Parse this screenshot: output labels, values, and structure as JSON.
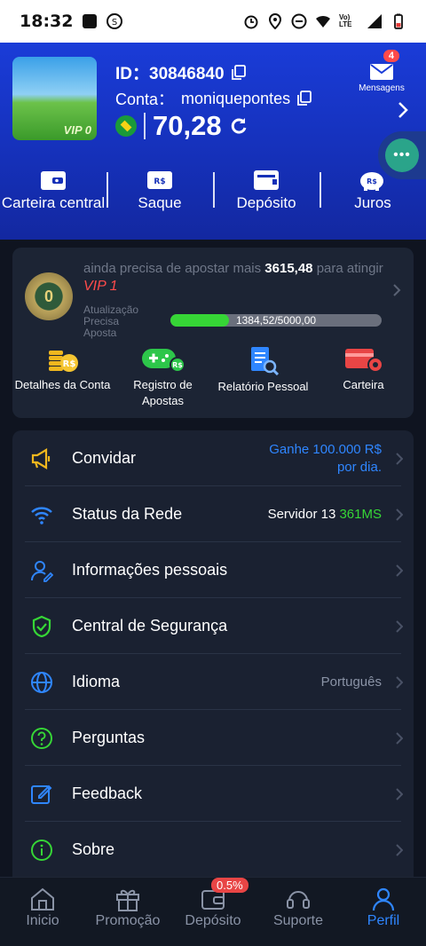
{
  "status_bar": {
    "time": "18:32",
    "network_label": "Vo) LTE"
  },
  "header": {
    "avatar_vip": "VIP 0",
    "id_label": "ID：",
    "id_value": "30846840",
    "account_label": "Conta：",
    "account_value": "moniquepontes",
    "balance": "70,28",
    "messages_label": "Mensagens",
    "messages_count": "4",
    "quick_actions": [
      {
        "label": "Carteira central",
        "icon": "wallet-icon"
      },
      {
        "label": "Saque",
        "icon": "withdraw-ticket-icon"
      },
      {
        "label": "Depósito",
        "icon": "deposit-wallet-icon"
      },
      {
        "label": "Juros",
        "icon": "piggy-bank-icon"
      }
    ]
  },
  "vip": {
    "medal_level": "0",
    "text_prefix": "ainda precisa de apostar mais",
    "amount_needed": "3615,48",
    "text_mid": "para atingir",
    "next_level": "VIP 1",
    "label_line1": "Atualização",
    "label_line2": "Precisa",
    "label_line3": "Aposta",
    "progress_text": "1384,52/5000,00",
    "progress_fraction": 0.2769,
    "actions": [
      {
        "label": "Detalhes da Conta",
        "icon": "coins-icon"
      },
      {
        "label": "Registro de Apostas",
        "icon": "gamepad-icon"
      },
      {
        "label": "Relatório Pessoal",
        "icon": "report-icon"
      },
      {
        "label": "Carteira",
        "icon": "card-settings-icon"
      }
    ]
  },
  "menu": [
    {
      "label": "Convidar",
      "right": "Ganhe 100.000 R$ por dia.",
      "icon": "megaphone-icon"
    },
    {
      "label": "Status da Rede",
      "right": "Servidor 13",
      "right_value": "361MS",
      "icon": "wifi-icon"
    },
    {
      "label": "Informações pessoais",
      "right": "",
      "icon": "user-edit-icon"
    },
    {
      "label": "Central de Segurança",
      "right": "",
      "icon": "shield-check-icon"
    },
    {
      "label": "Idioma",
      "right": "Português",
      "icon": "globe-icon"
    },
    {
      "label": "Perguntas",
      "right": "",
      "icon": "question-icon"
    },
    {
      "label": "Feedback",
      "right": "",
      "icon": "edit-icon"
    },
    {
      "label": "Sobre",
      "right": "",
      "icon": "info-icon"
    }
  ],
  "bottom_nav": [
    {
      "label": "Inicio",
      "icon": "home-icon"
    },
    {
      "label": "Promoção",
      "icon": "gift-icon"
    },
    {
      "label": "Depósito",
      "icon": "wallet-icon",
      "badge": "0.5%"
    },
    {
      "label": "Suporte",
      "icon": "headset-icon"
    },
    {
      "label": "Perfil",
      "icon": "person-icon",
      "active": true
    }
  ],
  "colors": {
    "header_blue": "#1a3cd8",
    "accent_green": "#36d636",
    "vip_red": "#ff4b4b",
    "active_blue": "#2f86ff",
    "invite_blue": "#2f86ff"
  }
}
